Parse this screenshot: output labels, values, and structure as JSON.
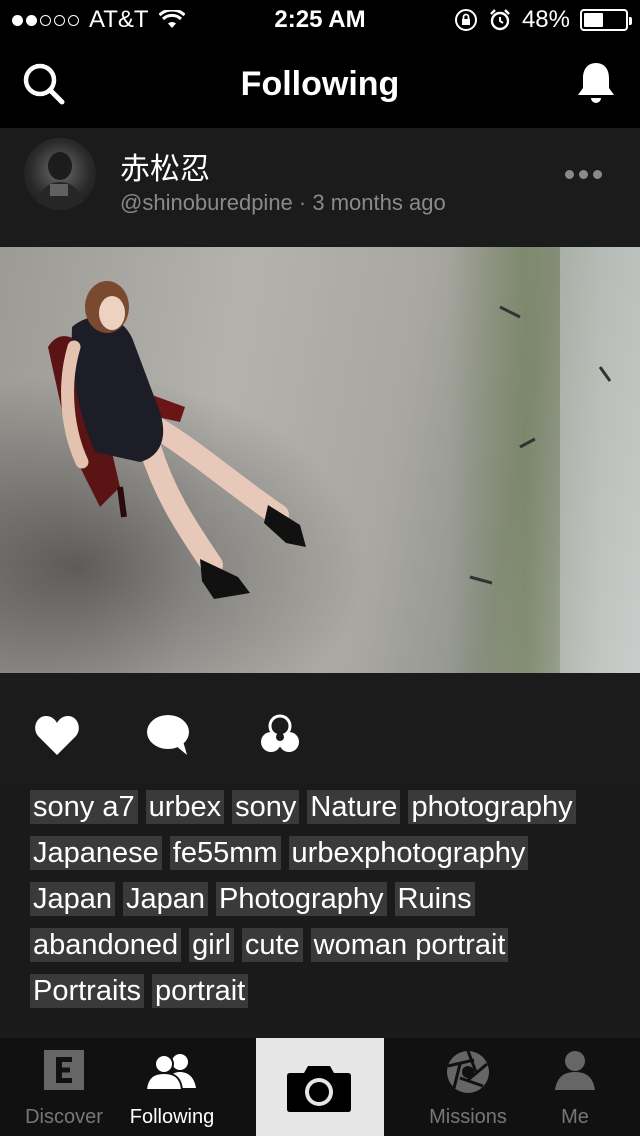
{
  "status_bar": {
    "carrier": "AT&T",
    "time": "2:25 AM",
    "battery": "48%",
    "battery_level": 0.48,
    "signal_bars": 2
  },
  "nav": {
    "title": "Following"
  },
  "post": {
    "author_name": "赤松忍",
    "handle": "@shinoburedpine",
    "separator": "·",
    "time_ago": "3 months ago"
  },
  "tags": [
    "sony a7",
    "urbex",
    "sony",
    "Nature ",
    "photography",
    "Japanese ",
    "fe55mm",
    "urbexphotography",
    "Japan",
    "Japan ",
    "Photography",
    "Ruins",
    "abandoned",
    "girl",
    "cute",
    "woman portrait",
    "Portraits",
    "portrait"
  ],
  "tab_bar": {
    "discover": "Discover",
    "following": "Following",
    "missions": "Missions",
    "me": "Me"
  },
  "icons": {
    "search": "search-icon",
    "bell": "bell-icon",
    "like": "heart-icon",
    "comment": "comment-icon",
    "add_to_gallery": "gallery-icon",
    "camera": "camera-icon"
  },
  "colors": {
    "background": "#1a1a1a",
    "bar": "#000000",
    "tag_bg": "#3a3a3a",
    "muted_text": "#8a8a8a",
    "camera_tab_bg": "#e6e6e6"
  }
}
